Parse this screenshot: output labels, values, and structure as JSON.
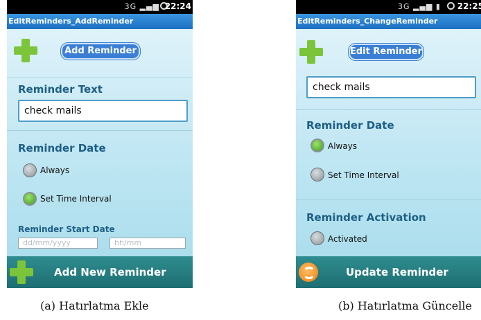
{
  "screen_a": {
    "status_time": "22:24",
    "status_network": "3G",
    "window_title": "EditReminders_AddReminder",
    "header_title": "Add Reminder",
    "reminder_text_label": "Reminder Text",
    "reminder_text_value": "check mails",
    "reminder_date_label": "Reminder Date",
    "option_always": "Always",
    "option_set_time_interval": "Set Time Interval",
    "selected_option": "Set Time Interval",
    "start_date_label": "Reminder Start Date",
    "date_placeholder": "dd/mm/yyyy",
    "time_placeholder": "hh/mm",
    "bottom_button": "Add New Reminder",
    "icons": [
      "plus-icon",
      "alarm-icon",
      "signal-icon"
    ]
  },
  "screen_b": {
    "status_time": "22:25",
    "status_network": "3G",
    "window_title": "EditReminders_ChangeReminder",
    "header_title": "Edit Reminder",
    "reminder_text_value": "check mails",
    "reminder_date_label": "Reminder Date",
    "option_always": "Always",
    "option_set_time_interval": "Set Time Interval",
    "selected_option": "Always",
    "activation_label": "Reminder Activation",
    "option_activated": "Activated",
    "bottom_button": "Update Reminder",
    "icons": [
      "plus-icon",
      "refresh-icon",
      "alarm-icon",
      "signal-icon",
      "battery-icon"
    ]
  },
  "captions": {
    "a": "(a) Hatırlatma Ekle",
    "b": "(b) Hatırlatma Güncelle"
  },
  "colors": {
    "accent_blue": "#1c6fc0",
    "label_blue": "#1e5f86",
    "bottom_teal": "#2e8d8f",
    "plus_green": "#7cc43a",
    "radio_on_green": "#3f9a20"
  }
}
